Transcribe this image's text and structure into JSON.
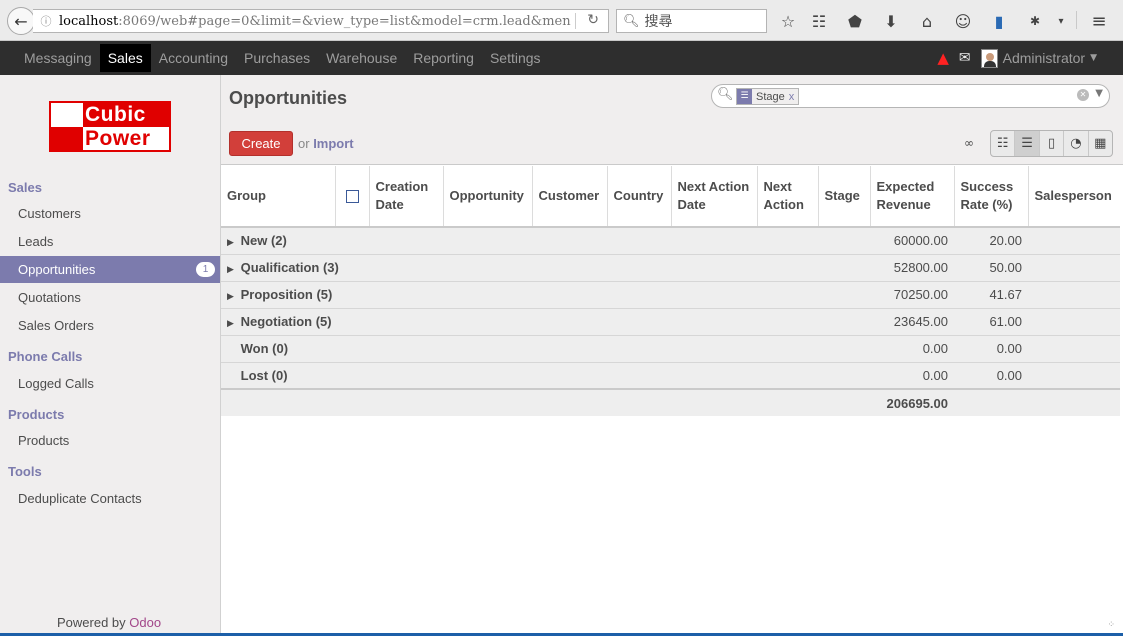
{
  "browser": {
    "url_host": "localhost",
    "url_path": ":8069/web#page=0&limit=&view_type=list&model=crm.lead&men",
    "search_placeholder": "搜尋"
  },
  "topbar": {
    "menus": [
      {
        "label": "Messaging"
      },
      {
        "label": "Sales"
      },
      {
        "label": "Accounting"
      },
      {
        "label": "Purchases"
      },
      {
        "label": "Warehouse"
      },
      {
        "label": "Reporting"
      },
      {
        "label": "Settings"
      }
    ],
    "active_menu": "Sales",
    "user": "Administrator"
  },
  "sidebar": {
    "logo_line1": "Cubic",
    "logo_line2": "Power",
    "sections": [
      {
        "title": "Sales",
        "items": [
          {
            "label": "Customers"
          },
          {
            "label": "Leads"
          },
          {
            "label": "Opportunities",
            "badge": "1",
            "active": true
          },
          {
            "label": "Quotations"
          },
          {
            "label": "Sales Orders"
          }
        ]
      },
      {
        "title": "Phone Calls",
        "items": [
          {
            "label": "Logged Calls"
          }
        ]
      },
      {
        "title": "Products",
        "items": [
          {
            "label": "Products"
          }
        ]
      },
      {
        "title": "Tools",
        "items": [
          {
            "label": "Deduplicate Contacts"
          }
        ]
      }
    ],
    "powered_by": "Powered by",
    "powered_brand": "Odoo"
  },
  "main": {
    "title": "Opportunities",
    "facet_label": "Stage",
    "facet_remove": "x",
    "create_label": "Create",
    "or_text": "or",
    "import_label": "Import",
    "infinity": "∞"
  },
  "table": {
    "headers": [
      "Group",
      "",
      "Creation Date",
      "Opportunity",
      "Customer",
      "Country",
      "Next Action Date",
      "Next Action",
      "Stage",
      "Expected Revenue",
      "Success Rate (%)",
      "Salesperson"
    ],
    "groups": [
      {
        "label": "New (2)",
        "expandable": true,
        "revenue": "60000.00",
        "rate": "20.00"
      },
      {
        "label": "Qualification (3)",
        "expandable": true,
        "revenue": "52800.00",
        "rate": "50.00"
      },
      {
        "label": "Proposition (5)",
        "expandable": true,
        "revenue": "70250.00",
        "rate": "41.67"
      },
      {
        "label": "Negotiation (5)",
        "expandable": true,
        "revenue": "23645.00",
        "rate": "61.00"
      },
      {
        "label": "Won (0)",
        "expandable": false,
        "revenue": "0.00",
        "rate": "0.00"
      },
      {
        "label": "Lost (0)",
        "expandable": false,
        "revenue": "0.00",
        "rate": "0.00"
      }
    ],
    "total_revenue": "206695.00"
  }
}
